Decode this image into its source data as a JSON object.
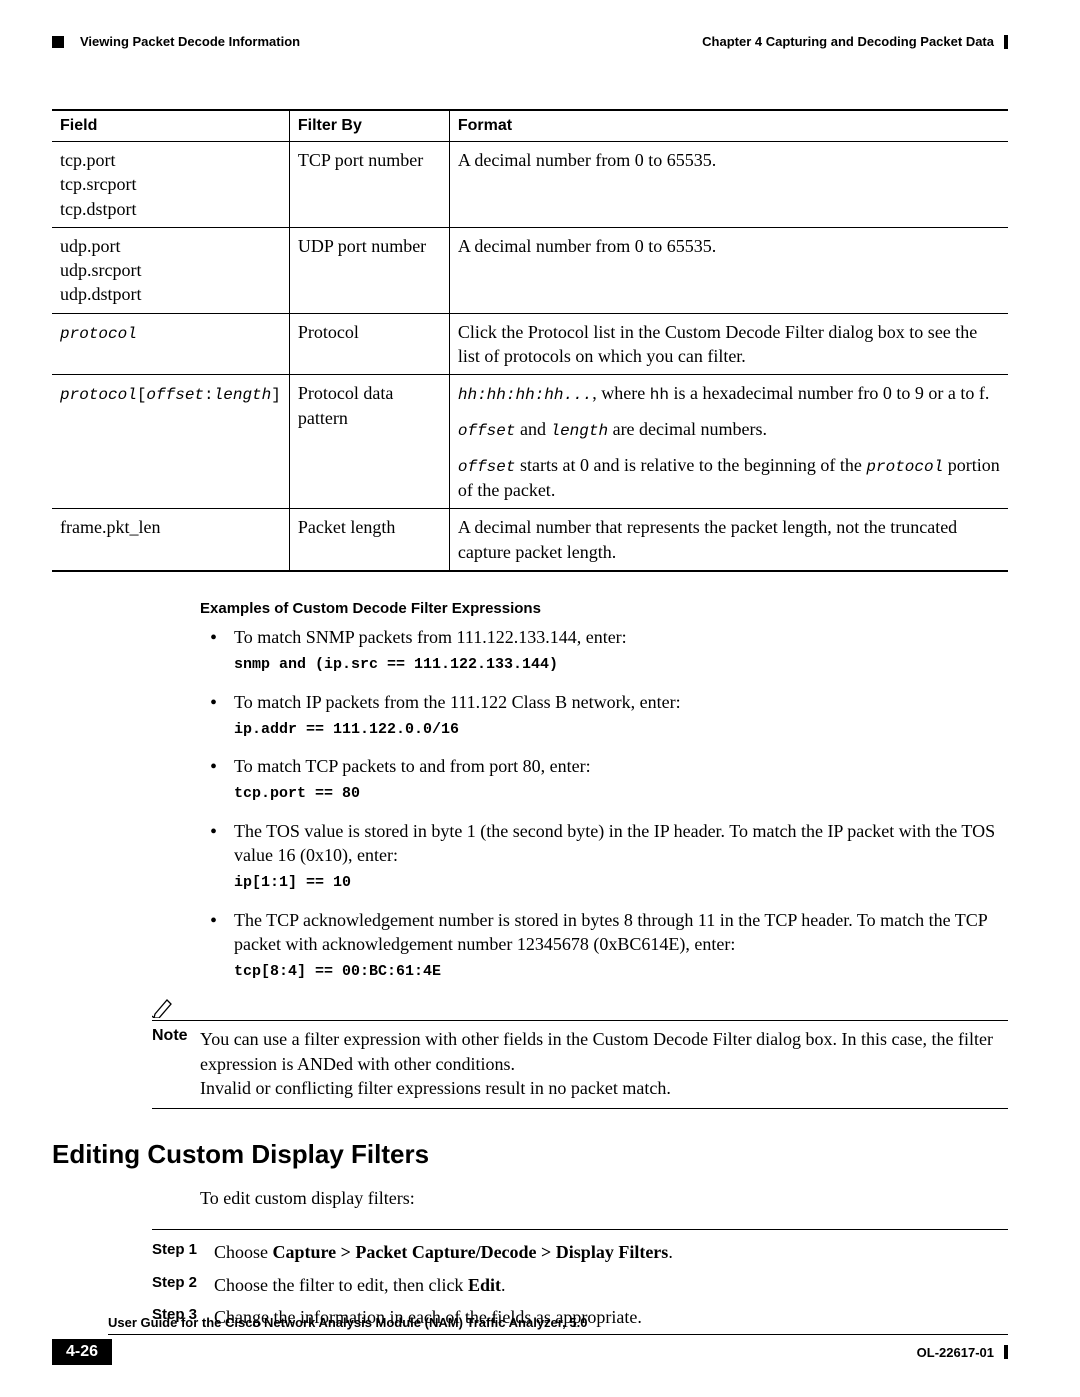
{
  "header": {
    "section": "Viewing Packet Decode Information",
    "chapter": "Chapter 4      Capturing and Decoding Packet Data"
  },
  "table": {
    "headers": {
      "c1": "Field",
      "c2": "Filter By",
      "c3": "Format"
    },
    "r1": {
      "c1a": "tcp.port",
      "c1b": "tcp.srcport",
      "c1c": "tcp.dstport",
      "c2": "TCP port number",
      "c3": "A decimal number from 0 to 65535."
    },
    "r2": {
      "c1a": "udp.port",
      "c1b": "udp.srcport",
      "c1c": "udp.dstport",
      "c2": "UDP port number",
      "c3": "A decimal number from 0 to 65535."
    },
    "r3": {
      "c1": "protocol",
      "c2": "Protocol",
      "c3": "Click the Protocol list in the Custom Decode Filter dialog box to see the list of protocols on which you can filter."
    },
    "r4": {
      "c1a": "protocol",
      "c1b": "[",
      "c1c": "offset",
      "c1d": ":",
      "c1e": "length",
      "c1f": "]",
      "c2": "Protocol data pattern",
      "c3a": "hh:hh:hh:hh...",
      "c3b": ", where ",
      "c3c": "hh",
      "c3d": " is a hexadecimal number fro 0 to 9 or a to f.",
      "c3e": "offset",
      "c3f": " and ",
      "c3g": "length",
      "c3h": " are decimal numbers.",
      "c3i": "offset",
      "c3j": " starts at 0 and is relative to the beginning of the ",
      "c3k": "protocol",
      "c3l": " portion of the packet."
    },
    "r5": {
      "c1": "frame.pkt_len",
      "c2": "Packet length",
      "c3": "A decimal number that represents the packet length, not the truncated capture packet length."
    }
  },
  "examples": {
    "title": "Examples of Custom Decode Filter Expressions",
    "e1": {
      "text": "To match SNMP packets from 111.122.133.144, enter:",
      "code": "snmp and (ip.src == 111.122.133.144)"
    },
    "e2": {
      "text": "To match IP packets from the 111.122 Class B network, enter:",
      "code": "ip.addr == 111.122.0.0/16"
    },
    "e3": {
      "text": "To match TCP packets to and from port 80, enter:",
      "code": "tcp.port == 80"
    },
    "e4": {
      "text": "The TOS value is stored in byte 1 (the second byte) in the IP header. To match the IP packet with the TOS value 16 (0x10), enter:",
      "code": "ip[1:1] == 10"
    },
    "e5": {
      "text": "The TCP acknowledgement number is stored in bytes 8 through 11 in the TCP header. To match the TCP packet with acknowledgement number 12345678 (0xBC614E), enter:",
      "code": "tcp[8:4] == 00:BC:61:4E"
    }
  },
  "note": {
    "label": "Note",
    "line1": "You can use a filter expression with other fields in the Custom Decode Filter dialog box. In this case, the filter expression is ANDed with other conditions.",
    "line2": "Invalid or conflicting filter expressions result in no packet match."
  },
  "section2": {
    "title": "Editing Custom Display Filters",
    "intro": "To edit custom display filters:",
    "s1l": "Step 1",
    "s1a": "Choose ",
    "s1b": "Capture > Packet Capture/Decode > Display Filters",
    "s1c": ".",
    "s2l": "Step 2",
    "s2a": "Choose the filter to edit, then click ",
    "s2b": "Edit",
    "s2c": ".",
    "s3l": "Step 3",
    "s3a": "Change the information in each of the fields as appropriate."
  },
  "footer": {
    "title": "User Guide for the Cisco Network Analysis Module (NAM) Traffic Analyzer, 5.0",
    "page": "4-26",
    "code": "OL-22617-01"
  }
}
